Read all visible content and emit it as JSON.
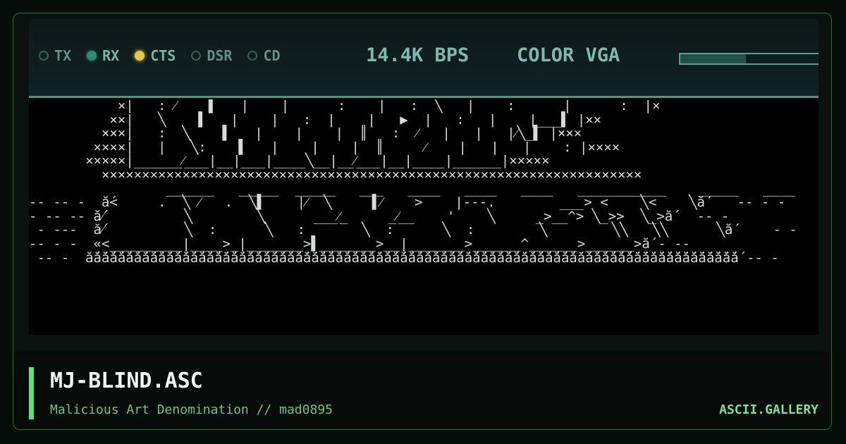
{
  "status_bar": {
    "indicators": [
      {
        "label": "TX",
        "state": "off"
      },
      {
        "label": "RX",
        "state": "on"
      },
      {
        "label": "CTS",
        "state": "on"
      },
      {
        "label": "DSR",
        "state": "off"
      },
      {
        "label": "CD",
        "state": "off"
      }
    ],
    "speed": "14.4K BPS",
    "mode": "COLOR VGA",
    "progress_level": 0.45
  },
  "art_text": "           ×|   : ⁄    ▌   |    |      :    |   :  ╲   |    :      |      :  |×\n          ××|   ╲    ▌   |    |   :  |    |   ▶  |   :   |    |___▌ |××\n         ×××|   :  ╲    ▌   |    |    |  ║   :  ⁄   |   |   |⁄╲_▌ |×××\n        ××××|   |   ╲:    ▌   |    |    |  ║     ⁄    |   |   |    : |××××\n       ×××××|______⁄___|__|___|____╲__|__⁄___|__|____|______|×××××\n         ×××××××××××××××××××××××××××××××××××××××××××××××××××××××××××××××××××\n                 ______   _____  _____   ___   ____   ____   ____   ___________    _____   ____\n-- -- -  ắ<     .  ╲ ⁄   .  ╲▌    |⁄  ╲     ▌⁄    >    |---.        ___> <    ╲<    ╲ắ    -- - -\n- -- -- ắ⁄          ╲        ╲      ___⁄_     _⁄__    '    ╲     _>__^> ╲_>>  ╲_>ắ   -- -\n - ---  ắ⁄          ╲  :      ╲   :       ╲  :      ╲  :        ╲        ╲╲   ╲╲      ╲ắ     - -\n-- - -  «<_________|____>_|_______>▌_______>__|_______>______^______>______>ắ - --\n -- -  ắắắắắắắắắắắắắắắắắắắắắắắắắắắắắắắắắắắắắắắắắắắắắắắắắắắắắắắắắắắắắắắắắắắắắắắắắắắắắắắắắ -- -",
  "caption": {
    "title": "MJ-BLIND.ASC",
    "subtitle": "Malicious Art Denomination // mad0895",
    "brand": "ASCII.GALLERY"
  },
  "colors": {
    "accent": "#5fe07a",
    "cts_led": "#e6c64a",
    "rx_led": "#2f8a73",
    "status_text": "#7fb8ae"
  }
}
